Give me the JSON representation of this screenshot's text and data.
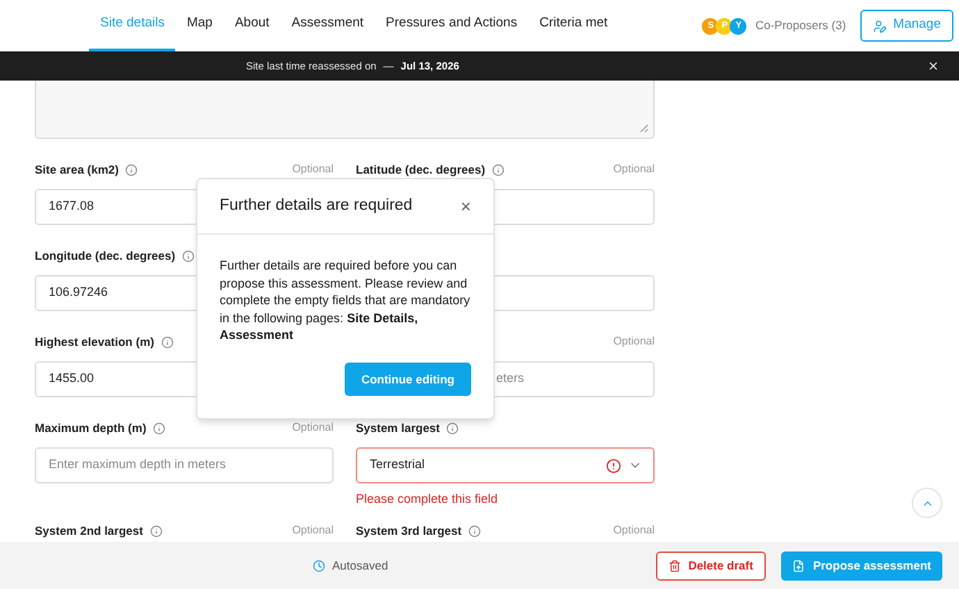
{
  "nav": {
    "tabs": [
      {
        "label": "Site details",
        "selected": true
      },
      {
        "label": "Map",
        "selected": false
      },
      {
        "label": "About",
        "selected": false
      },
      {
        "label": "Assessment",
        "selected": false
      },
      {
        "label": "Pressures and Actions",
        "selected": false
      },
      {
        "label": "Criteria met",
        "selected": false
      }
    ],
    "avatars": [
      {
        "letter": "S",
        "color": "#f59e0b"
      },
      {
        "letter": "P",
        "color": "#facc15"
      },
      {
        "letter": "Y",
        "color": "#0ea5e9"
      }
    ],
    "proposers_label": "Co-Proposers (3)",
    "manage_button": "Manage"
  },
  "banner": {
    "text": "Site last time reassessed on",
    "dash": "—",
    "date": "Jul 13, 2026"
  },
  "form": {
    "rows": [
      [
        {
          "kind": "input",
          "label": "Site area (km2)",
          "optional": "Optional",
          "value": "1677.08"
        },
        {
          "kind": "input",
          "label": "Latitude (dec. degrees)",
          "optional": "Optional"
        }
      ],
      [
        {
          "kind": "input",
          "label": "Longitude (dec. degrees)",
          "value": "106.97246"
        },
        {
          "kind": "input"
        }
      ],
      [
        {
          "kind": "input",
          "label": "Highest elevation (m)",
          "value": "1455.00"
        },
        {
          "kind": "covered_input",
          "optional": "Optional",
          "placeholder": "eters"
        }
      ],
      [
        {
          "kind": "input",
          "label": "Maximum depth (m)",
          "optional": "Optional",
          "placeholder": "Enter maximum depth in meters"
        },
        {
          "kind": "select",
          "label": "System largest",
          "value": "Terrestrial",
          "error": "Please complete this field"
        }
      ],
      [
        {
          "kind": "none",
          "label": "System 2nd largest",
          "optional": "Optional"
        },
        {
          "kind": "none",
          "label": "System 3rd largest",
          "optional": "Optional"
        }
      ]
    ]
  },
  "modal": {
    "title": "Further details are required",
    "close": "×",
    "body": "Further details are required before you can propose this assessment. Please review and complete the empty fields that are mandatory in the following pages: **Site Details, Assessment**",
    "button": "Continue editing"
  },
  "footer": {
    "status": "Autosaved",
    "delete_button": "Delete draft",
    "propose_button": "Propose assessment"
  }
}
